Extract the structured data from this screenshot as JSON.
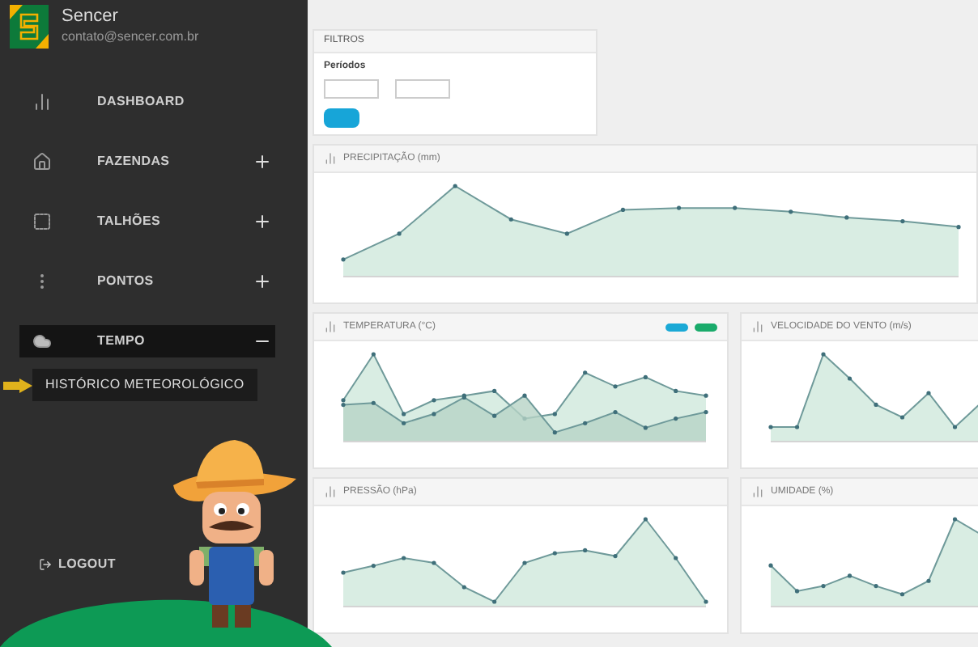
{
  "user": {
    "name": "Sencer",
    "email": "contato@sencer.com.br"
  },
  "menu": [
    {
      "label": "DASHBOARD",
      "expandable": false,
      "expanded": false
    },
    {
      "label": "FAZENDAS",
      "expandable": true,
      "expanded": false
    },
    {
      "label": "TALHÕES",
      "expandable": true,
      "expanded": false
    },
    {
      "label": "PONTOS",
      "expandable": true,
      "expanded": false
    },
    {
      "label": "TEMPO",
      "expandable": true,
      "expanded": true,
      "children": [
        {
          "label": "HISTÓRICO METEOROLÓGICO",
          "selected": true
        }
      ]
    }
  ],
  "logout": "LOGOUT",
  "filters": {
    "title": "FILTROS",
    "period_label": "Períodos"
  },
  "panels": [
    {
      "title": "PRECIPITAÇÃO (mm)",
      "kind": "wide"
    },
    {
      "title": "TEMPERATURA (°C)",
      "kind": "double",
      "legend": [
        {
          "color": "#1ba9d6",
          "selected": true
        },
        {
          "color": "#1aab6b",
          "selected": true
        }
      ]
    },
    {
      "title": "VELOCIDADE DO VENTO (m/s)",
      "kind": "single"
    },
    {
      "title": "PRESSÃO (hPa)",
      "kind": "single"
    },
    {
      "title": "UMIDADE (%)",
      "kind": "single"
    }
  ]
}
